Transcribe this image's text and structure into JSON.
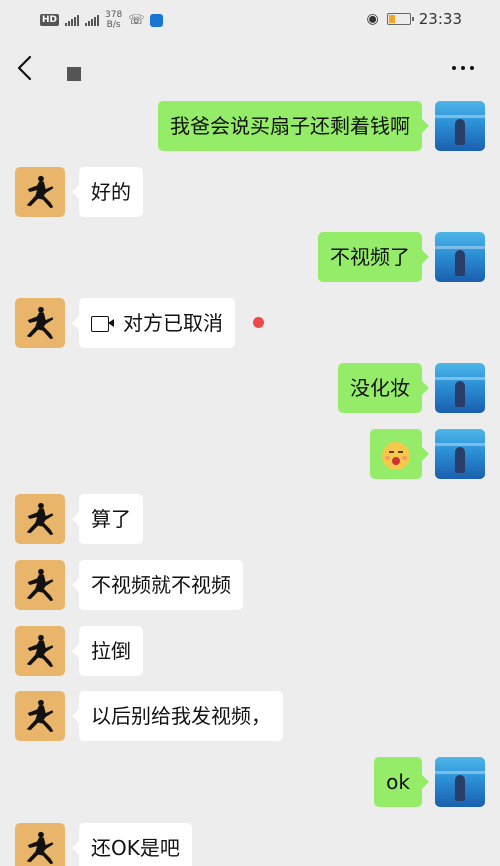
{
  "status_bar": {
    "hd_badge": "HD",
    "net_speed_value": "378",
    "net_speed_unit": "B/s",
    "time": "23:33",
    "battery_level": 0.35,
    "battery_color": "#f5a623"
  },
  "header": {
    "back_icon": "chevron-left-icon",
    "more_icon": "more-dots-icon"
  },
  "colors": {
    "sent_bubble": "#95ec69",
    "received_bubble": "#ffffff",
    "background": "#ededed",
    "unread_dot": "#f04848"
  },
  "messages": [
    {
      "side": "right",
      "text": "我爸会说买扇子还剩着钱啊"
    },
    {
      "side": "left",
      "text": "好的"
    },
    {
      "side": "right",
      "text": "不视频了"
    },
    {
      "side": "left",
      "text": "对方已取消",
      "icon": "video-call-icon"
    },
    {
      "side": "right",
      "text": "没化妆"
    },
    {
      "side": "right",
      "emoji": "blushing-face-emoji"
    },
    {
      "side": "left",
      "text": "算了"
    },
    {
      "side": "left",
      "text": "不视频就不视频"
    },
    {
      "side": "left",
      "text": "拉倒"
    },
    {
      "side": "left",
      "text": "以后别给我发视频，"
    },
    {
      "side": "right",
      "text": "ok"
    },
    {
      "side": "left",
      "text": "还OK是吧"
    }
  ]
}
